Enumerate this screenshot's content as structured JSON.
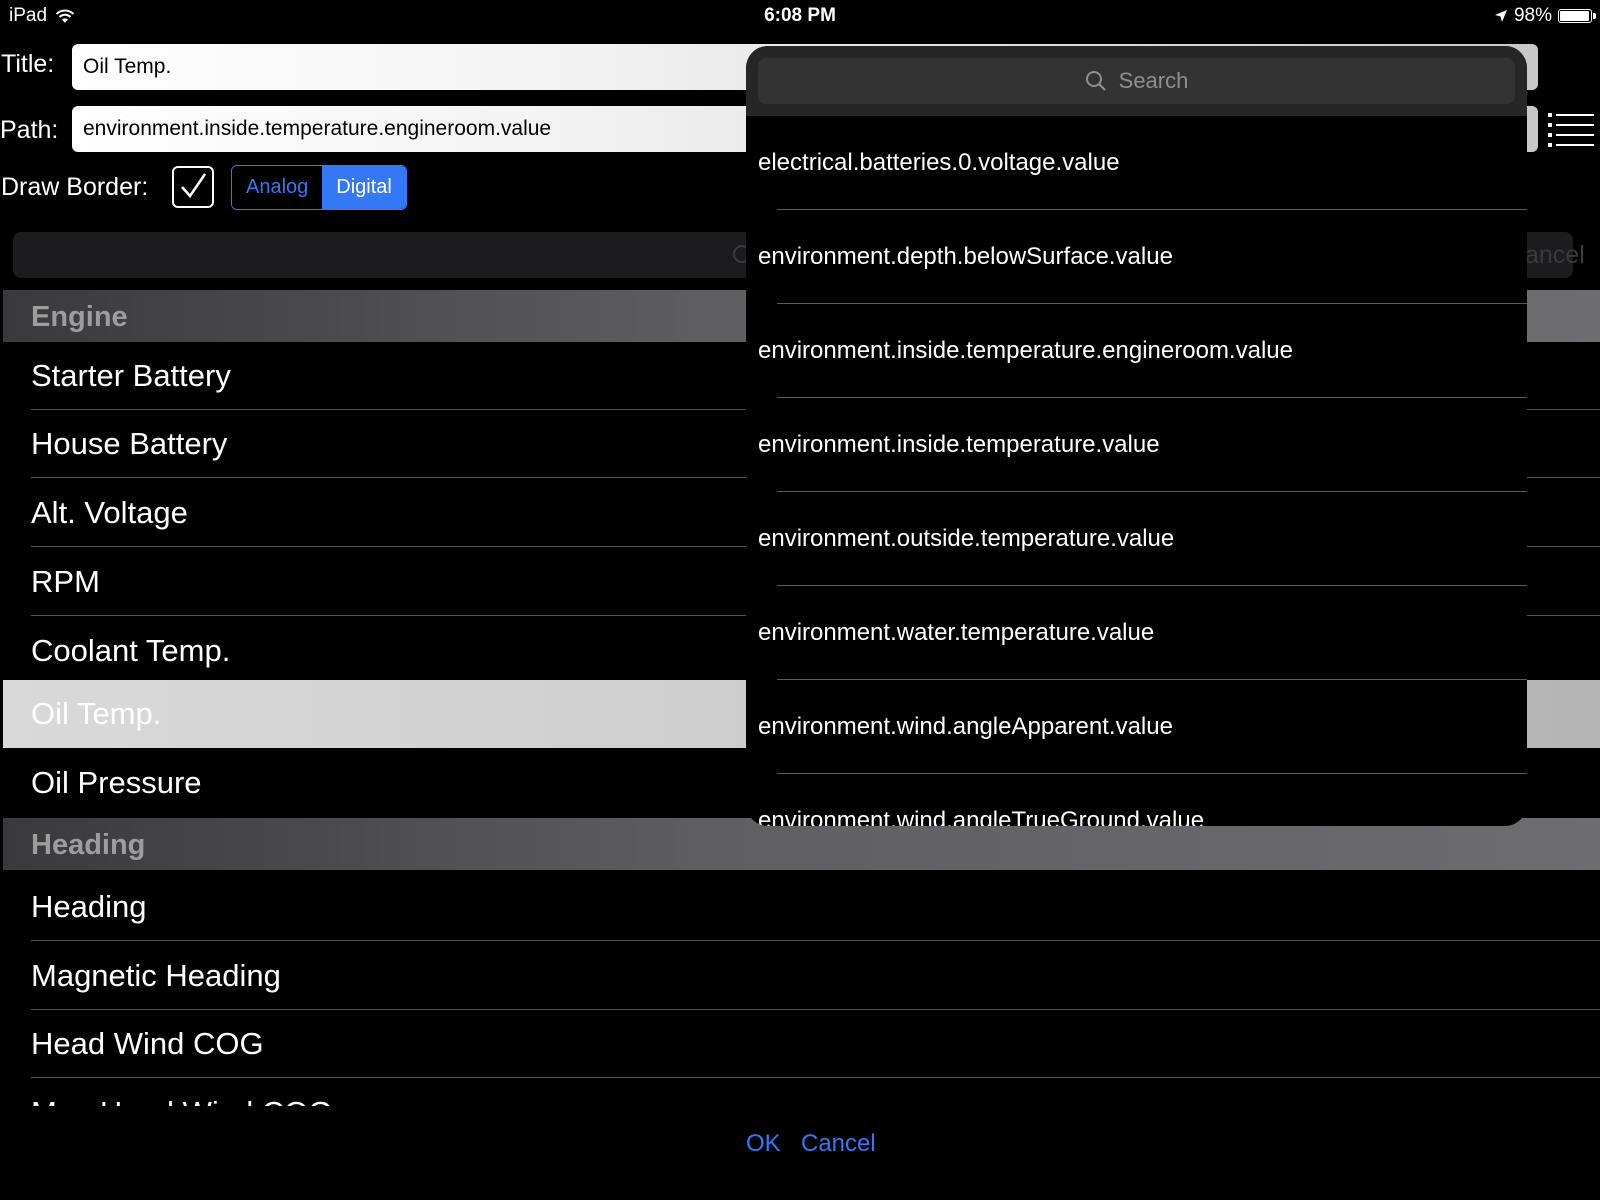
{
  "status": {
    "device": "iPad",
    "time": "6:08 PM",
    "battery": "98%",
    "battery_level": 0.98
  },
  "form": {
    "title_label": "Title:",
    "title_value": "Oil Temp.",
    "path_label": "Path:",
    "path_value": "environment.inside.temperature.engineroom.value",
    "border_label": "Draw Border:",
    "border_checked": true,
    "segments": [
      "Analog",
      "Digital"
    ],
    "selected_segment": "Digital"
  },
  "list_search": {
    "cancel_label": "ancel"
  },
  "sections": [
    {
      "header": "Engine",
      "items": [
        "Starter Battery",
        "House Battery",
        "Alt. Voltage",
        "RPM",
        "Coolant Temp.",
        "Oil Temp.",
        "Oil Pressure"
      ],
      "selected": "Oil Temp."
    },
    {
      "header": "Heading",
      "items": [
        "Heading",
        "Magnetic Heading",
        "Head Wind COG",
        "Mag Head Wind COG"
      ]
    }
  ],
  "popover": {
    "search_placeholder": "Search",
    "items": [
      "electrical.batteries.0.voltage.value",
      "environment.depth.belowSurface.value",
      "environment.inside.temperature.engineroom.value",
      "environment.inside.temperature.value",
      "environment.outside.temperature.value",
      "environment.water.temperature.value",
      "environment.wind.angleApparent.value",
      "environment.wind.angleTrueGround.value"
    ]
  },
  "actions": {
    "ok": "OK",
    "cancel": "Cancel"
  },
  "colors": {
    "accent": "#3478f6",
    "section_bg": "#5f5f62",
    "selected_row": "#d0d0d0"
  }
}
